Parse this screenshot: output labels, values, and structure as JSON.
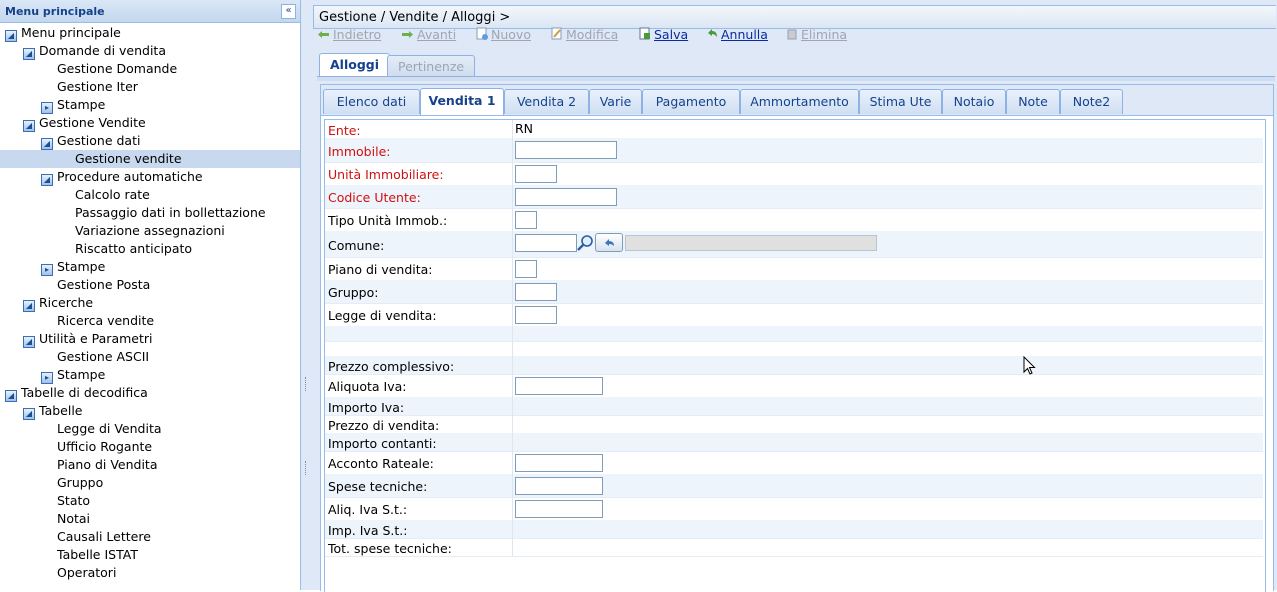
{
  "menu": {
    "header": "Menu principale",
    "collapse_glyph": "«",
    "items": [
      {
        "label": "Menu principale",
        "icon": "folder-open-icon"
      },
      {
        "label": "Domande di vendita",
        "icon": "folder-open-icon"
      },
      {
        "label": "Gestione Domande"
      },
      {
        "label": "Gestione Iter"
      },
      {
        "label": "Stampe",
        "icon": "folder-closed-icon"
      },
      {
        "label": "Gestione Vendite",
        "icon": "folder-open-icon"
      },
      {
        "label": "Gestione dati",
        "icon": "folder-open-icon"
      },
      {
        "label": "Gestione vendite",
        "selected": true
      },
      {
        "label": "Procedure automatiche",
        "icon": "folder-open-icon"
      },
      {
        "label": "Calcolo rate"
      },
      {
        "label": "Passaggio dati in bollettazione"
      },
      {
        "label": "Variazione assegnazioni"
      },
      {
        "label": "Riscatto anticipato"
      },
      {
        "label": "Stampe",
        "icon": "folder-closed-icon"
      },
      {
        "label": "Gestione Posta"
      },
      {
        "label": "Ricerche",
        "icon": "folder-open-icon"
      },
      {
        "label": "Ricerca vendite"
      },
      {
        "label": "Utilità e Parametri",
        "icon": "folder-open-icon"
      },
      {
        "label": "Gestione ASCII"
      },
      {
        "label": "Stampe",
        "icon": "folder-closed-icon"
      },
      {
        "label": "Tabelle di decodifica",
        "icon": "folder-open-icon"
      },
      {
        "label": "Tabelle",
        "icon": "folder-open-icon"
      },
      {
        "label": "Legge di Vendita"
      },
      {
        "label": "Ufficio Rogante"
      },
      {
        "label": "Piano di Vendita"
      },
      {
        "label": "Gruppo"
      },
      {
        "label": "Stato"
      },
      {
        "label": "Notai"
      },
      {
        "label": "Causali Lettere"
      },
      {
        "label": "Tabelle ISTAT"
      },
      {
        "label": "Operatori"
      }
    ]
  },
  "breadcrumb": "Gestione / Vendite / Alloggi >",
  "toolbar": {
    "indietro": "Indietro",
    "avanti": "Avanti",
    "nuovo": "Nuovo",
    "modifica": "Modifica",
    "salva": "Salva",
    "annulla": "Annulla",
    "elimina": "Elimina"
  },
  "tabs_main": [
    "Alloggi",
    "Pertinenze"
  ],
  "tabs_sub": [
    "Elenco dati",
    "Vendita 1",
    "Vendita 2",
    "Varie",
    "Pagamento",
    "Ammortamento",
    "Stima Ute",
    "Notaio",
    "Note",
    "Note2"
  ],
  "form": {
    "ente_label": "Ente:",
    "ente_value": "RN",
    "immobile_label": "Immobile:",
    "unita_label": "Unità Immobiliare:",
    "codice_utente_label": "Codice Utente:",
    "tipo_unita_label": "Tipo Unità Immob.:",
    "comune_label": "Comune:",
    "piano_label": "Piano di vendita:",
    "gruppo_label": "Gruppo:",
    "legge_label": "Legge di vendita:",
    "prezzo_complessivo_label": "Prezzo complessivo:",
    "aliquota_iva_label": "Aliquota Iva:",
    "importo_iva_label": "Importo Iva:",
    "prezzo_vendita_label": "Prezzo di vendita:",
    "importo_contanti_label": "Importo contanti:",
    "acconto_label": "Acconto Rateale:",
    "spese_tecniche_label": "Spese tecniche:",
    "aliq_iva_st_label": "Aliq. Iva S.t.:",
    "imp_iva_st_label": "Imp. Iva S.t.:",
    "tot_spese_label": "Tot. spese tecniche:"
  },
  "colors": {
    "required_label": "#d01010",
    "link": "#0a2aa0",
    "panel_bg": "#dfe8f6",
    "border": "#99bbe8"
  }
}
